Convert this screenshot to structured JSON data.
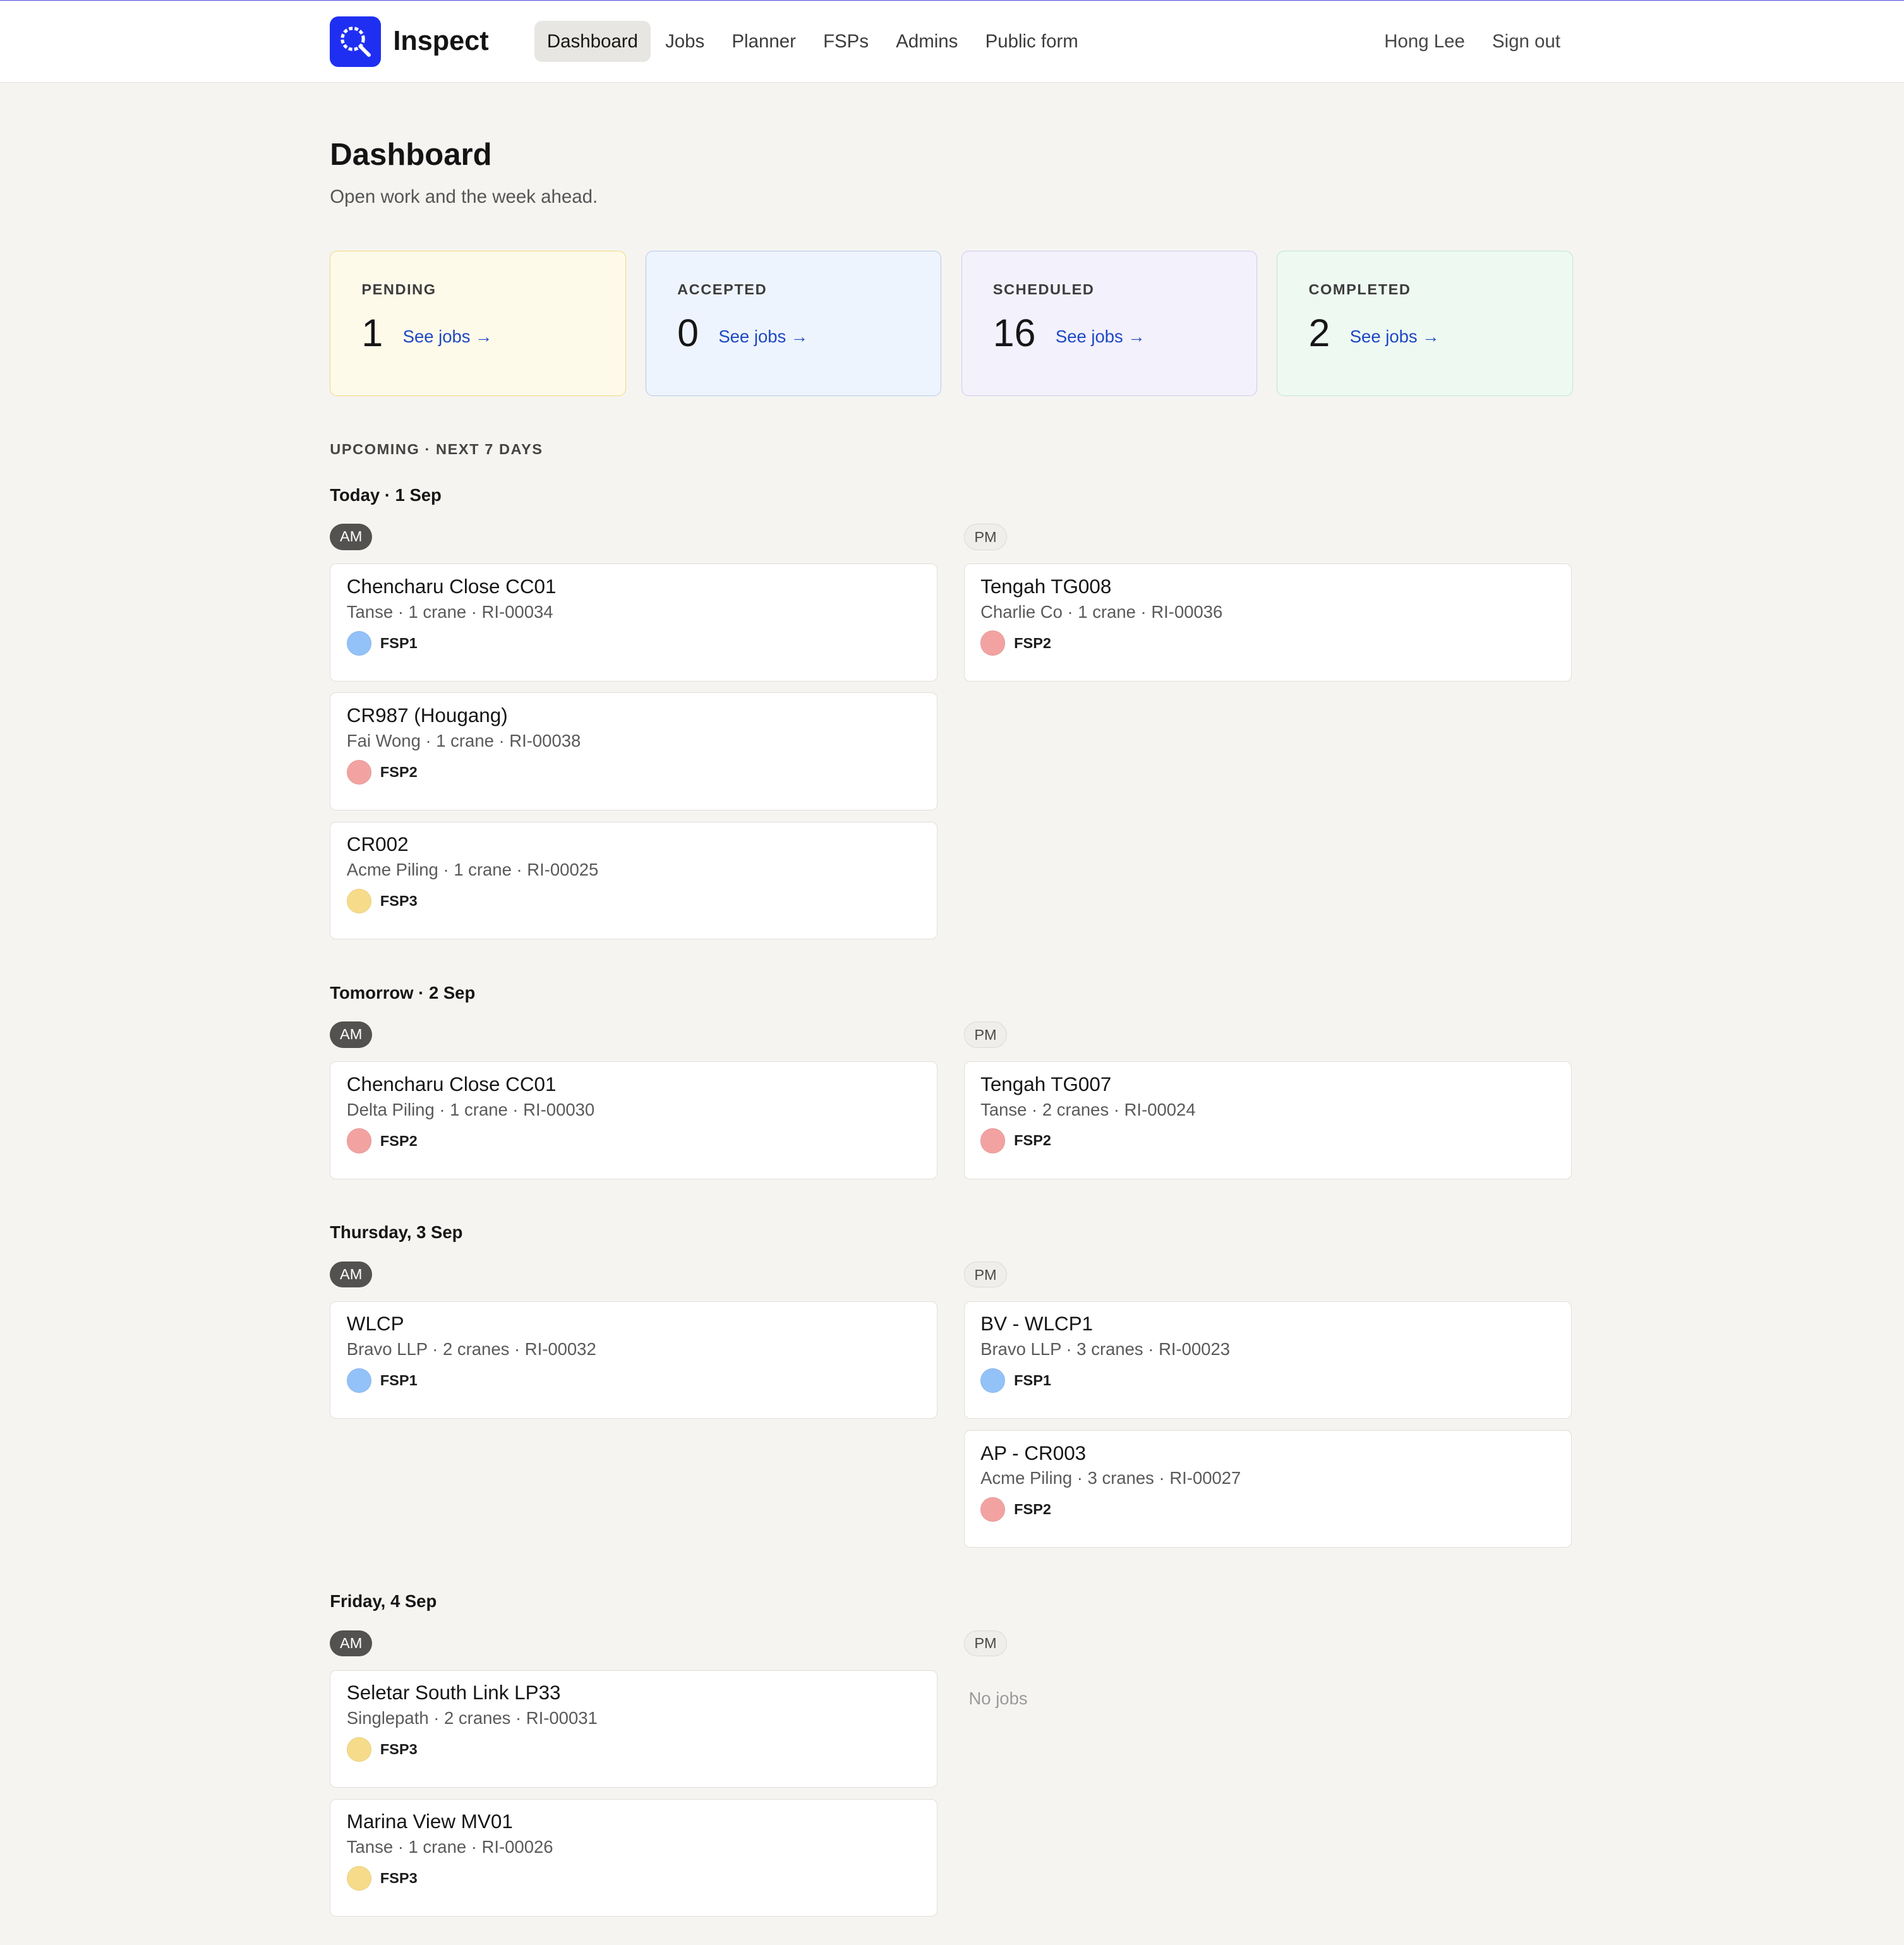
{
  "app": {
    "brand": "Inspect",
    "nav": [
      "Dashboard",
      "Jobs",
      "Planner",
      "FSPs",
      "Admins",
      "Public form"
    ],
    "user": "Hong Lee",
    "sign_out": "Sign out"
  },
  "page": {
    "title": "Dashboard",
    "subtitle": "Open work and the week ahead."
  },
  "stats": [
    {
      "label": "PENDING",
      "count": "1",
      "link": "See jobs →",
      "accent": "#f3d77f"
    },
    {
      "label": "ACCEPTED",
      "count": "0",
      "link": "See jobs →",
      "accent": "#b3caed"
    },
    {
      "label": "SCHEDULED",
      "count": "16",
      "link": "See jobs →",
      "accent": "#cfc9ef"
    },
    {
      "label": "COMPLETED",
      "count": "2",
      "link": "See jobs →",
      "accent": "#bfe6cd"
    }
  ],
  "upcoming_label": "UPCOMING · NEXT 7 DAYS",
  "fsp_colors": {
    "FSP1": "#93c2f8",
    "FSP2": "#f2a3a1",
    "FSP3": "#f6dc8a"
  },
  "days": [
    {
      "title": "Today · 1 Sep",
      "am_label": "AM",
      "pm_label": "PM",
      "am": [
        {
          "title": "Chencharu Close CC01",
          "meta": "Tanse · 1 crane · RI-00034",
          "fsp": "FSP1"
        },
        {
          "title": "CR987 (Hougang)",
          "meta": "Fai Wong · 1 crane · RI-00038",
          "fsp": "FSP2"
        },
        {
          "title": "CR002",
          "meta": "Acme Piling · 1 crane · RI-00025",
          "fsp": "FSP3"
        }
      ],
      "pm": [
        {
          "title": "Tengah TG008",
          "meta": "Charlie Co · 1 crane · RI-00036",
          "fsp": "FSP2"
        }
      ]
    },
    {
      "title": "Tomorrow · 2 Sep",
      "am_label": "AM",
      "pm_label": "PM",
      "am": [
        {
          "title": "Chencharu Close CC01",
          "meta": "Delta Piling · 1 crane · RI-00030",
          "fsp": "FSP2"
        }
      ],
      "pm": [
        {
          "title": "Tengah TG007",
          "meta": "Tanse · 2 cranes · RI-00024",
          "fsp": "FSP2"
        }
      ]
    },
    {
      "title": "Thursday, 3 Sep",
      "am_label": "AM",
      "pm_label": "PM",
      "am": [
        {
          "title": "WLCP",
          "meta": "Bravo LLP · 2 cranes · RI-00032",
          "fsp": "FSP1"
        }
      ],
      "pm": [
        {
          "title": "BV - WLCP1",
          "meta": "Bravo LLP · 3 cranes · RI-00023",
          "fsp": "FSP1"
        },
        {
          "title": "AP - CR003",
          "meta": "Acme Piling · 3 cranes · RI-00027",
          "fsp": "FSP2"
        }
      ]
    },
    {
      "title": "Friday, 4 Sep",
      "am_label": "AM",
      "pm_label": "PM",
      "am": [
        {
          "title": "Seletar South Link LP33",
          "meta": "Singlepath · 2 cranes · RI-00031",
          "fsp": "FSP3"
        },
        {
          "title": "Marina View MV01",
          "meta": "Tanse · 1 crane · RI-00026",
          "fsp": "FSP3"
        }
      ],
      "pm": [],
      "pm_empty": "No jobs"
    }
  ]
}
